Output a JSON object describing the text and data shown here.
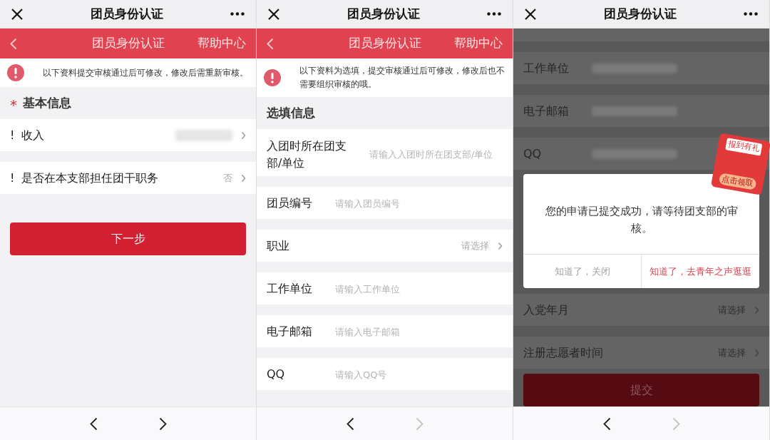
{
  "phones": [
    {
      "dimmed": false,
      "top_bar": {
        "title": "团员身份认证"
      },
      "header": {
        "title": "团员身份认证",
        "link": "帮助中心"
      },
      "notice": "以下资料提交审核通过后可修改，修改后需重新审核。",
      "section": {
        "required_mark": "*",
        "title": "基本信息"
      },
      "rows": [
        {
          "mark": "!",
          "label": "收入",
          "kind": "blurred_select"
        },
        {
          "mark": "!",
          "label": "是否在本支部担任团干职务",
          "kind": "select",
          "value": "否"
        }
      ],
      "button": {
        "label": "下一步"
      },
      "nav": {
        "forward_enabled": true
      }
    },
    {
      "dimmed": false,
      "top_bar": {
        "title": "团员身份认证"
      },
      "header": {
        "title": "团员身份认证",
        "link": "帮助中心"
      },
      "notice": "以下资料为选填，提交审核通过后可修改，修改后也不需要组织审核的哦。",
      "section": {
        "title": "选填信息"
      },
      "rows": [
        {
          "label": "入团时所在团支部/单位",
          "kind": "input",
          "placeholder": "请输入入团时所在团支部/单位"
        },
        {
          "label": "团员编号",
          "kind": "input",
          "placeholder": "请输入团员编号"
        },
        {
          "label": "职业",
          "kind": "select",
          "value": "请选择"
        },
        {
          "label": "工作单位",
          "kind": "input",
          "placeholder": "请输入工作单位"
        },
        {
          "label": "电子邮箱",
          "kind": "input",
          "placeholder": "请输入电子邮箱"
        },
        {
          "label": "QQ",
          "kind": "input",
          "placeholder": "请输入QQ号"
        }
      ],
      "nav": {
        "forward_enabled": false
      }
    },
    {
      "dimmed": true,
      "top_bar": {
        "title": "团员身份认证"
      },
      "rows": [
        {
          "label": "工作单位",
          "kind": "blurred_input"
        },
        {
          "label": "电子邮箱",
          "kind": "blurred_input"
        },
        {
          "label": "QQ",
          "kind": "blurred_input"
        }
      ],
      "dialog": {
        "message": "您的申请已提交成功，请等待团支部的审核。",
        "buttons": [
          {
            "label": "知道了，关闭",
            "kind": "secondary"
          },
          {
            "label": "知道了，去青年之声逛逛",
            "kind": "primary"
          }
        ],
        "promo": {
          "title": "报到有礼",
          "action": "点击领取"
        }
      },
      "rows_below": [
        {
          "label": "入党年月",
          "kind": "select",
          "value": "请选择"
        },
        {
          "label": "注册志愿者时间",
          "kind": "select",
          "value": "请选择"
        }
      ],
      "button": {
        "label": "提交"
      },
      "nav": {
        "forward_enabled": false
      }
    }
  ]
}
